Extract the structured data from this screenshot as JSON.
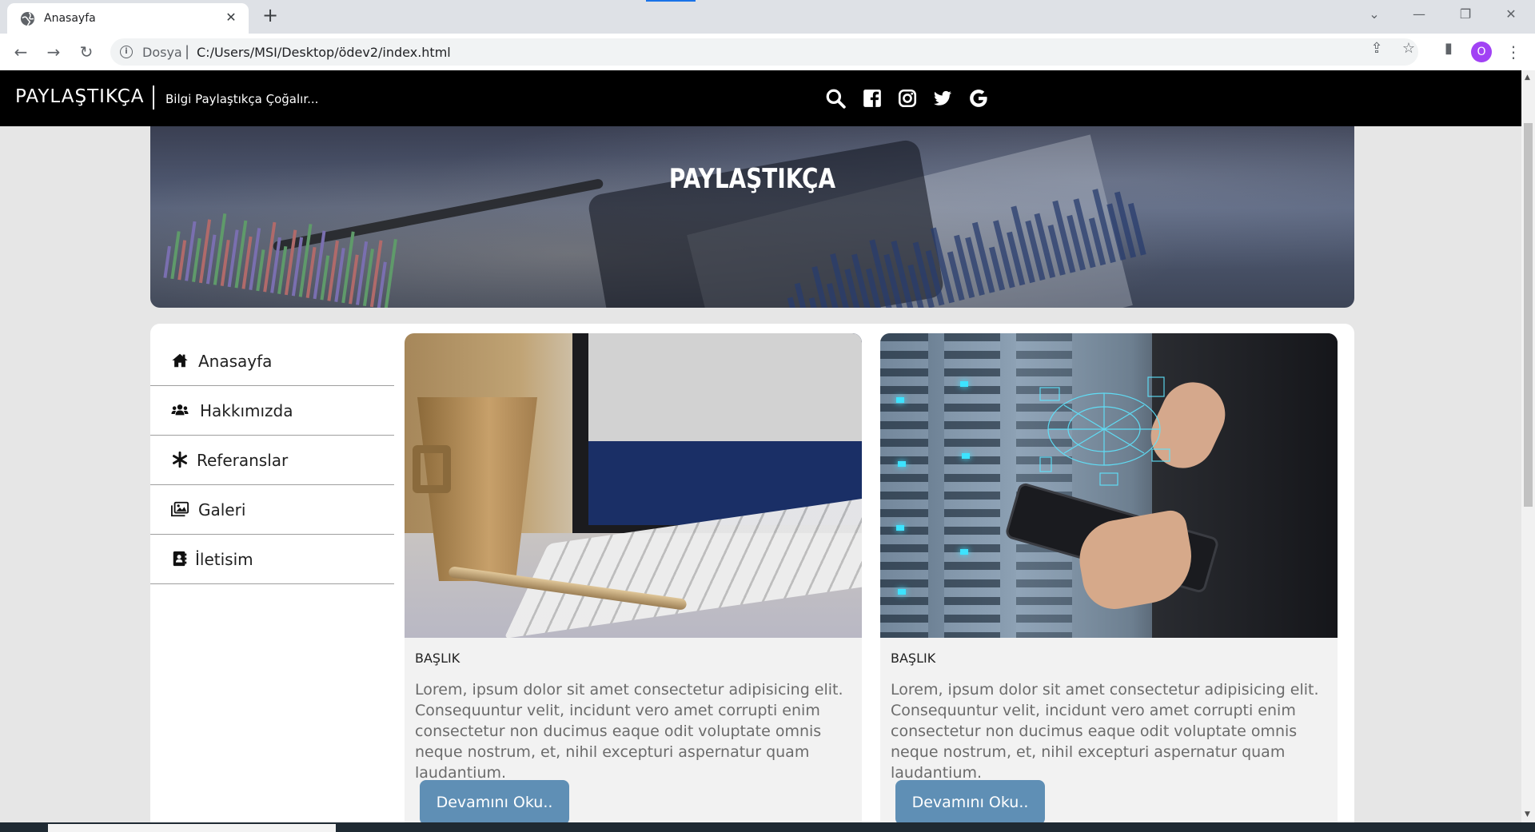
{
  "browser": {
    "tab_title": "Anasayfa",
    "tab_close": "✕",
    "new_tab": "+",
    "window_controls": [
      "⌄",
      "—",
      "❐",
      "✕"
    ],
    "address": {
      "scheme_label": "Dosya",
      "separator": "|",
      "url": "C:/Users/MSI/Desktop/ödev2/index.html"
    },
    "profile_initial": "O",
    "menu": "⋮"
  },
  "site": {
    "brand": "PAYLAŞTIKÇA",
    "tagline": "Bilgi Paylaştıkça Çoğalır...",
    "social_icons": [
      "search-icon",
      "facebook-icon",
      "instagram-icon",
      "twitter-icon",
      "google-icon"
    ],
    "hero_title": "PAYLAŞTIKÇA"
  },
  "sidebar": {
    "items": [
      {
        "label": "Anasayfa",
        "icon": "home-icon"
      },
      {
        "label": "Hakkımızda",
        "icon": "users-icon"
      },
      {
        "label": "Referanslar",
        "icon": "asterisk-icon"
      },
      {
        "label": "Galeri",
        "icon": "images-icon"
      },
      {
        "label": "İletisim",
        "icon": "contact-book-icon"
      }
    ]
  },
  "cards": [
    {
      "heading": "BAŞLIK",
      "text": "Lorem, ipsum dolor sit amet consectetur adipisicing elit. Consequuntur velit, incidunt vero amet corrupti enim consectetur non ducimus eaque odit voluptate omnis neque nostrum, et, nihil excepturi aspernatur quam laudantium.",
      "button": "Devamını Oku.."
    },
    {
      "heading": "BAŞLIK",
      "text": "Lorem, ipsum dolor sit amet consectetur adipisicing elit. Consequuntur velit, incidunt vero amet corrupti enim consectetur non ducimus eaque odit voluptate omnis neque nostrum, et, nihil excepturi aspernatur quam laudantium.",
      "button": "Devamını Oku.."
    }
  ],
  "colors": {
    "nav_bg": "#000000",
    "button_bg": "#5f8fb5",
    "page_bg": "#e6e6e6"
  }
}
